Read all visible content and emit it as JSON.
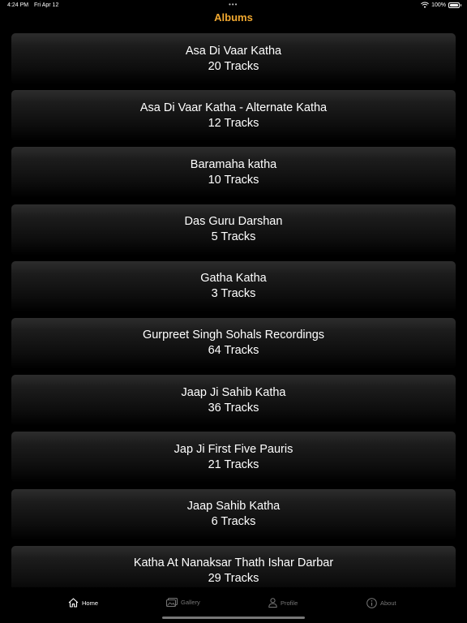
{
  "status": {
    "time": "4:24 PM",
    "date": "Fri Apr 12",
    "multitask_dots": "•••",
    "battery": "100%",
    "battery_level": 1.0
  },
  "header": {
    "title": "Albums"
  },
  "colors": {
    "accent": "#f0a830",
    "background": "#000000",
    "inactive_tab": "#777777"
  },
  "albums": [
    {
      "title": "Asa Di Vaar Katha",
      "tracks": "20 Tracks"
    },
    {
      "title": "Asa Di Vaar Katha - Alternate Katha",
      "tracks": "12 Tracks"
    },
    {
      "title": "Baramaha katha",
      "tracks": "10 Tracks"
    },
    {
      "title": "Das Guru Darshan",
      "tracks": "5 Tracks"
    },
    {
      "title": "Gatha Katha",
      "tracks": "3 Tracks"
    },
    {
      "title": "Gurpreet Singh Sohals Recordings",
      "tracks": "64 Tracks"
    },
    {
      "title": "Jaap Ji Sahib Katha",
      "tracks": "36 Tracks"
    },
    {
      "title": "Jap Ji First Five Pauris",
      "tracks": "21 Tracks"
    },
    {
      "title": "Jaap Sahib Katha",
      "tracks": "6 Tracks"
    },
    {
      "title": "Katha At Nanaksar Thath Ishar Darbar",
      "tracks": "29 Tracks"
    }
  ],
  "tabs": [
    {
      "label": "Home",
      "icon": "house-icon",
      "active": true
    },
    {
      "label": "Gallery",
      "icon": "gallery-icon",
      "active": false
    },
    {
      "label": "Profile",
      "icon": "person-icon",
      "active": false
    },
    {
      "label": "About",
      "icon": "info-icon",
      "active": false
    }
  ]
}
